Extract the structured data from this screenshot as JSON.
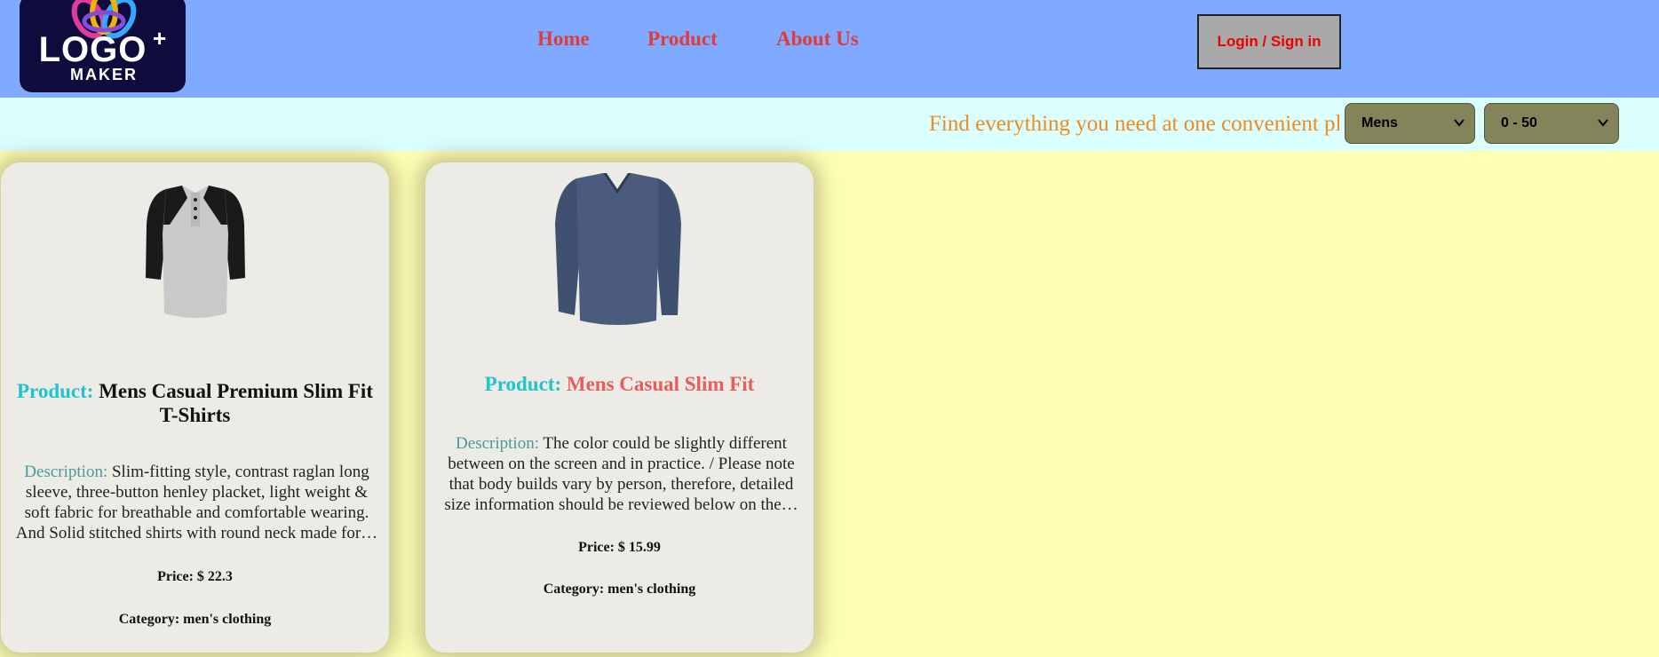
{
  "header": {
    "logo": {
      "word": "LOGO",
      "plus": "+",
      "sub": "MAKER"
    },
    "nav": [
      "Home",
      "Product",
      "About Us"
    ],
    "login_label": "Login / Sign in"
  },
  "subbar": {
    "marquee": "Find everything you need at one convenient place",
    "category_select": "Mens",
    "price_select": "0 - 50"
  },
  "products": [
    {
      "product_label": "Product:",
      "name": "Mens Casual Premium Slim Fit T-Shirts",
      "description_label": "Description:",
      "description": "Slim-fitting style, contrast raglan long sleeve, three-button henley placket, light weight & soft fabric for breathable and comfortable wearing. And Solid stitched shirts with round neck made for…",
      "price": "Price: $ 22.3",
      "category": "Category: men's clothing",
      "name_color": "#111111"
    },
    {
      "product_label": "Product:",
      "name": "Mens Casual Slim Fit",
      "description_label": "Description:",
      "description": "The color could be slightly different between on the screen and in practice. / Please note that body builds vary by person, therefore, detailed size information should be reviewed below on the…",
      "price": "Price: $ 15.99",
      "category": "Category: men's clothing",
      "name_color": "#e85c5c"
    }
  ],
  "colors": {
    "header_bg": "#80aaff",
    "subbar_bg": "#dbffff",
    "page_bg": "#ffffb3",
    "nav_text": "#e03a3a",
    "product_label": "#1fc4cc",
    "marquee_text": "#f08a1e"
  }
}
